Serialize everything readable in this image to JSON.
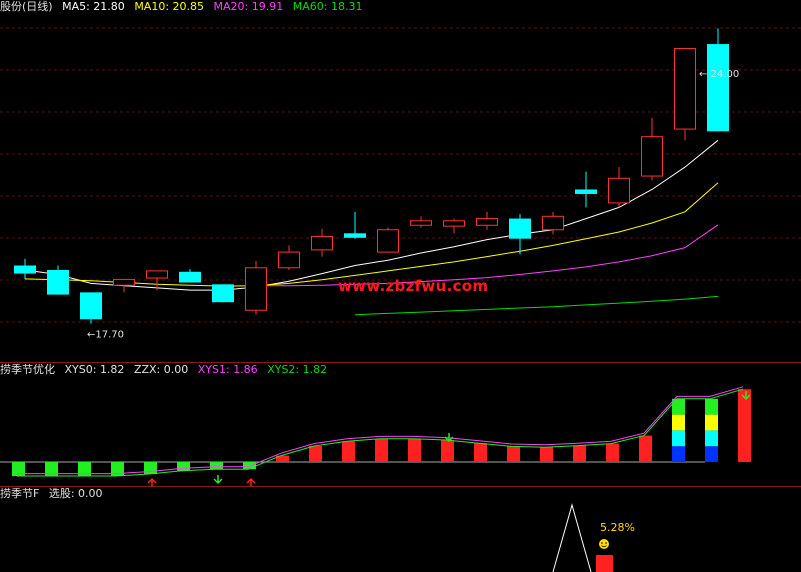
{
  "main": {
    "title": "股份(日线)",
    "ma": [
      {
        "label": "MA5: 21.80",
        "color": "#ffffff"
      },
      {
        "label": "MA10: 20.85",
        "color": "#ffff00"
      },
      {
        "label": "MA20: 19.91",
        "color": "#ff40ff"
      },
      {
        "label": "MA60: 18.31",
        "color": "#00dd00"
      }
    ],
    "high_label": "24.00",
    "low_label": "17.70",
    "watermark": "www.zbzfwu.com"
  },
  "indicator": {
    "title": "捞季节优化",
    "fields": [
      {
        "label": "XYS0: 1.82",
        "color": "#e0e0e0"
      },
      {
        "label": "ZZX: 0.00",
        "color": "#e0e0e0"
      },
      {
        "label": "XYS1: 1.86",
        "color": "#ff40ff"
      },
      {
        "label": "XYS2: 1.82",
        "color": "#00dd00"
      }
    ]
  },
  "selector": {
    "title": "捞季节F",
    "fields": [
      {
        "label": "选股: 0.00",
        "color": "#e0e0e0"
      }
    ],
    "signal_label": "5.28%"
  },
  "chart_data": {
    "type": "candlestick",
    "y_range": [
      17.0,
      24.6
    ],
    "candles": [
      {
        "open": 19.0,
        "high": 19.15,
        "low": 18.7,
        "close": 18.82
      },
      {
        "open": 18.9,
        "high": 19.0,
        "low": 18.35,
        "close": 18.35
      },
      {
        "open": 18.4,
        "high": 18.4,
        "low": 17.7,
        "close": 17.8
      },
      {
        "open": 18.56,
        "high": 18.7,
        "low": 18.4,
        "close": 18.69
      },
      {
        "open": 18.72,
        "high": 18.85,
        "low": 18.45,
        "close": 18.88
      },
      {
        "open": 18.86,
        "high": 18.92,
        "low": 18.62,
        "close": 18.62
      },
      {
        "open": 18.58,
        "high": 18.58,
        "low": 18.18,
        "close": 18.18
      },
      {
        "open": 18.0,
        "high": 19.1,
        "low": 17.9,
        "close": 18.95
      },
      {
        "open": 18.95,
        "high": 19.45,
        "low": 18.9,
        "close": 19.3
      },
      {
        "open": 19.35,
        "high": 19.82,
        "low": 19.2,
        "close": 19.65
      },
      {
        "open": 19.72,
        "high": 20.2,
        "low": 19.6,
        "close": 19.62
      },
      {
        "open": 19.3,
        "high": 19.85,
        "low": 19.3,
        "close": 19.8
      },
      {
        "open": 19.9,
        "high": 20.1,
        "low": 19.85,
        "close": 20.0
      },
      {
        "open": 19.88,
        "high": 20.05,
        "low": 19.72,
        "close": 20.0
      },
      {
        "open": 19.9,
        "high": 20.2,
        "low": 19.8,
        "close": 20.05
      },
      {
        "open": 20.05,
        "high": 20.15,
        "low": 19.25,
        "close": 19.6
      },
      {
        "open": 19.8,
        "high": 20.2,
        "low": 19.7,
        "close": 20.1
      },
      {
        "open": 20.7,
        "high": 21.1,
        "low": 20.3,
        "close": 20.6
      },
      {
        "open": 20.4,
        "high": 21.2,
        "low": 20.3,
        "close": 20.95
      },
      {
        "open": 21.0,
        "high": 22.3,
        "low": 20.9,
        "close": 21.88
      },
      {
        "open": 22.05,
        "high": 23.3,
        "low": 21.8,
        "close": 23.85
      },
      {
        "open": 23.95,
        "high": 24.3,
        "low": 22.2,
        "close": 22.0
      }
    ],
    "ma": [
      {
        "name": "MA5",
        "color": "#ffffff",
        "values": [
          18.9,
          18.8,
          18.6,
          18.55,
          18.5,
          18.45,
          18.45,
          18.52,
          18.65,
          18.82,
          19.0,
          19.12,
          19.28,
          19.42,
          19.58,
          19.7,
          19.8,
          20.05,
          20.3,
          20.7,
          21.2,
          21.8
        ]
      },
      {
        "name": "MA10",
        "color": "#ffff00",
        "values": [
          18.7,
          18.68,
          18.66,
          18.62,
          18.58,
          18.56,
          18.54,
          18.55,
          18.6,
          18.68,
          18.78,
          18.88,
          18.98,
          19.08,
          19.2,
          19.32,
          19.45,
          19.6,
          19.75,
          19.95,
          20.2,
          20.85
        ]
      },
      {
        "name": "MA20",
        "color": "#ff40ff",
        "values": [
          null,
          null,
          null,
          null,
          null,
          null,
          null,
          18.55,
          18.55,
          18.56,
          18.58,
          18.6,
          18.64,
          18.68,
          18.73,
          18.8,
          18.88,
          18.97,
          19.08,
          19.22,
          19.4,
          19.91
        ]
      },
      {
        "name": "MA60",
        "color": "#00dd00",
        "values": [
          null,
          null,
          null,
          null,
          null,
          null,
          null,
          null,
          null,
          null,
          17.9,
          17.93,
          17.96,
          17.99,
          18.02,
          18.05,
          18.08,
          18.12,
          18.16,
          18.2,
          18.25,
          18.31
        ]
      }
    ],
    "indicator_bars": [
      -0.35,
      -0.35,
      -0.35,
      -0.35,
      -0.3,
      -0.22,
      -0.18,
      -0.18,
      0.16,
      0.4,
      0.52,
      0.58,
      0.58,
      0.55,
      0.47,
      0.39,
      0.37,
      0.41,
      0.46,
      0.66,
      1.58,
      1.58,
      1.82
    ],
    "selector_signal": {
      "bar_index": 18,
      "value": 5.28
    }
  }
}
